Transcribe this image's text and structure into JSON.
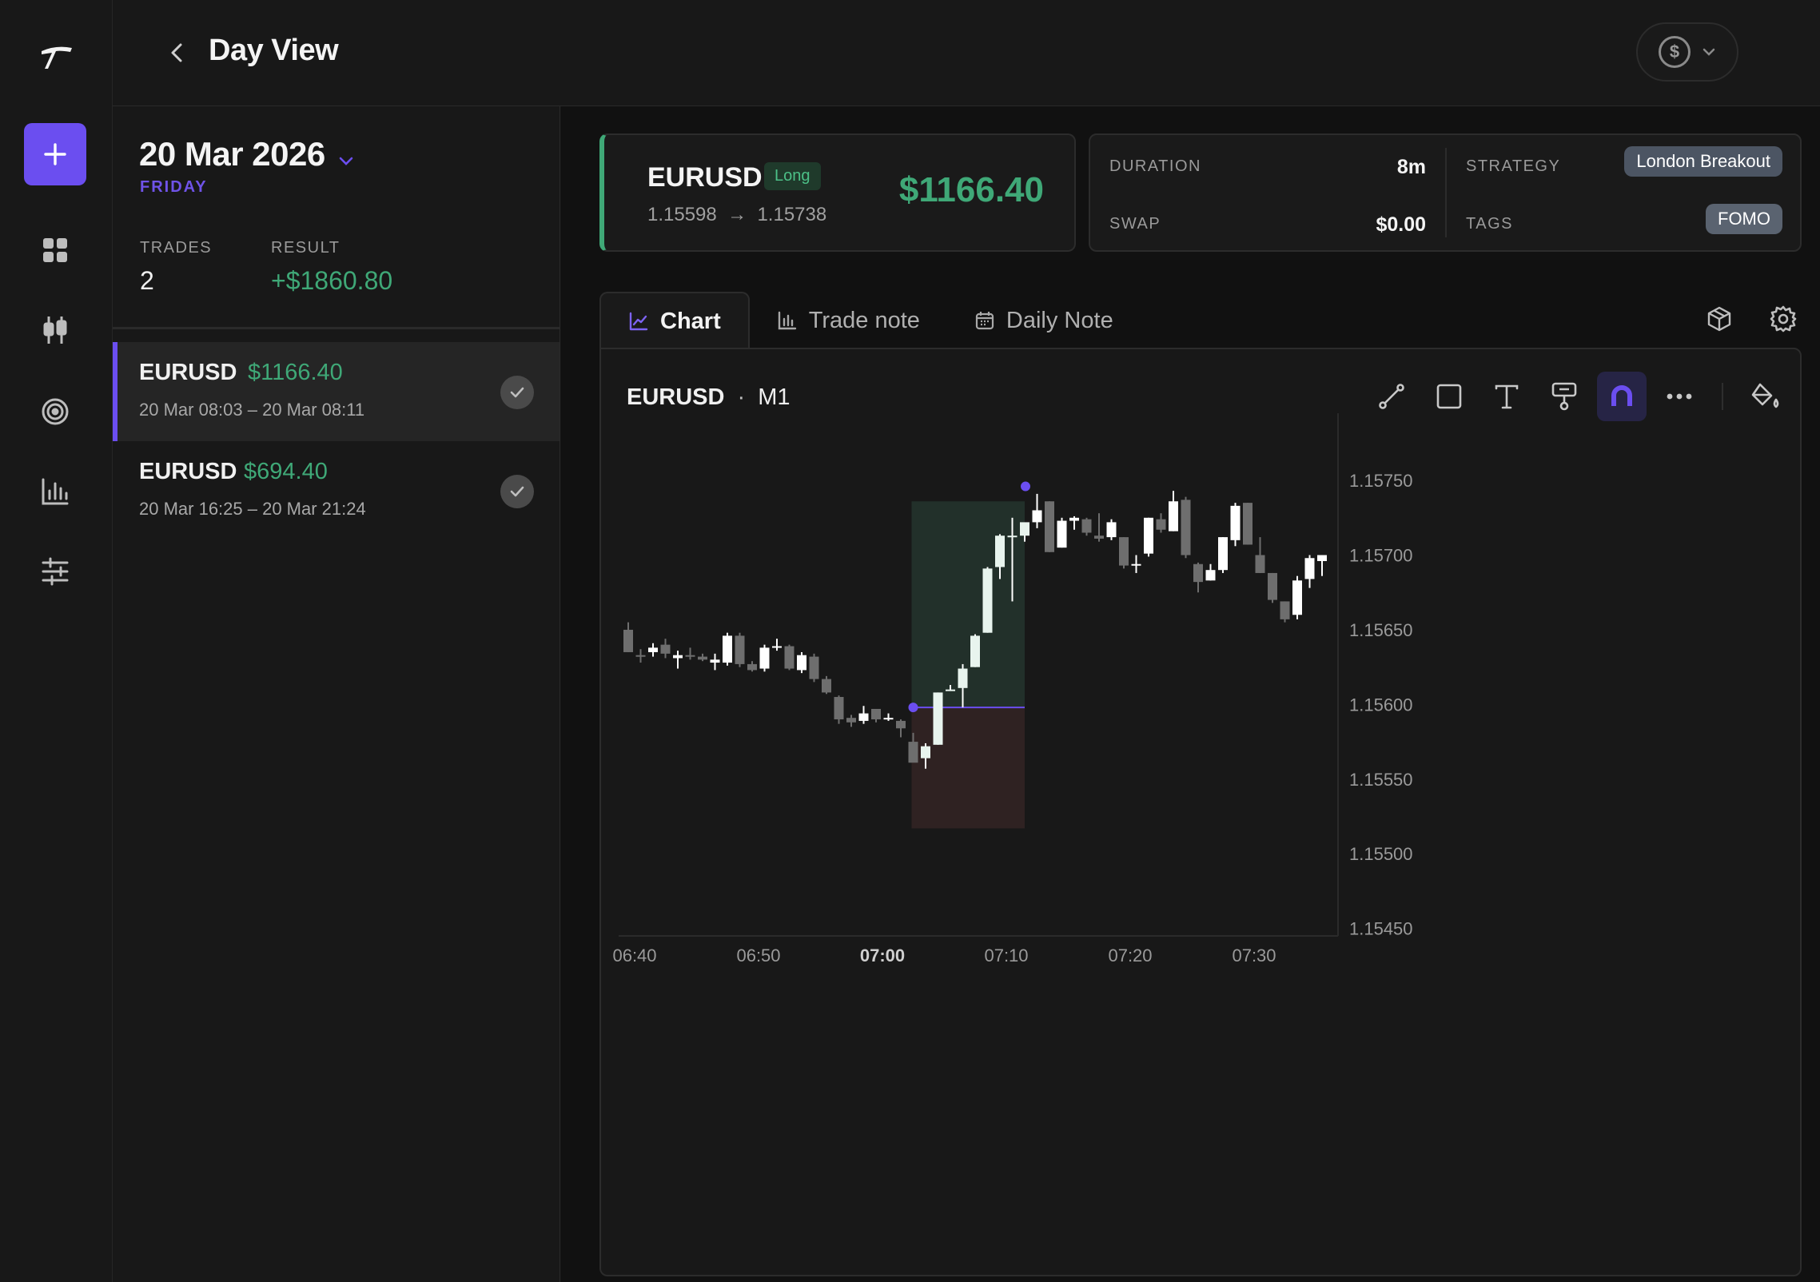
{
  "header": {
    "title": "Day View",
    "currency_symbol": "$"
  },
  "day": {
    "date": "20 Mar 2026",
    "weekday": "FRIDAY",
    "trades_label": "TRADES",
    "trades_value": "2",
    "result_label": "RESULT",
    "result_value": "+$1860.80"
  },
  "trades": [
    {
      "symbol": "EURUSD",
      "pnl": "$1166.40",
      "time": "20 Mar 08:03 – 20 Mar 08:11",
      "active": true
    },
    {
      "symbol": "EURUSD",
      "pnl": "$694.40",
      "time": "20 Mar 16:25 – 20 Mar 21:24",
      "active": false
    }
  ],
  "selected_trade": {
    "symbol": "EURUSD",
    "direction": "Long",
    "entry": "1.15598",
    "arrow": "→",
    "exit": "1.15738",
    "pnl": "$1166.40",
    "duration_label": "DURATION",
    "duration_value": "8m",
    "swap_label": "SWAP",
    "swap_value": "$0.00",
    "strategy_label": "STRATEGY",
    "strategy_value": "London Breakout",
    "tags_label": "TAGS",
    "tags_value": "FOMO"
  },
  "tabs": [
    {
      "label": "Chart",
      "active": true
    },
    {
      "label": "Trade note",
      "active": false
    },
    {
      "label": "Daily Note",
      "active": false
    }
  ],
  "chart_header": {
    "symbol": "EURUSD",
    "separator": "·",
    "timeframe": "M1"
  },
  "colors": {
    "accent": "#6b4ef0",
    "profit": "#3fa877",
    "bull_candle": "#ffffff",
    "bear_candle": "#6e6e6e",
    "profit_zone": "#22302a",
    "loss_zone": "#2f2222"
  },
  "chart_data": {
    "type": "candlestick",
    "y_ticks": [
      "1.15750",
      "1.15700",
      "1.15650",
      "1.15600",
      "1.15550",
      "1.15500",
      "1.15450"
    ],
    "ylim": [
      1.15445,
      1.15795
    ],
    "x_ticks": [
      {
        "label": "06:40",
        "minute": 0,
        "bold": false
      },
      {
        "label": "06:50",
        "minute": 10,
        "bold": false
      },
      {
        "label": "07:00",
        "minute": 20,
        "bold": true
      },
      {
        "label": "07:10",
        "minute": 30,
        "bold": false
      },
      {
        "label": "07:20",
        "minute": 40,
        "bold": false
      },
      {
        "label": "07:30",
        "minute": 50,
        "bold": false
      }
    ],
    "trade_entry": {
      "minute": 23,
      "price": 1.15598
    },
    "trade_exit": {
      "minute": 32,
      "price": 1.15738
    },
    "profit_zone": {
      "minute_start": 23,
      "minute_end": 32,
      "price_top": 1.15736,
      "price_bottom": 1.15598
    },
    "loss_zone": {
      "minute_start": 23,
      "minute_end": 32,
      "price_top": 1.15598,
      "price_bottom": 1.15517
    },
    "candles": [
      [
        1.1565,
        1.15655,
        1.15635,
        1.15635
      ],
      [
        1.15633,
        1.15637,
        1.15628,
        1.15632
      ],
      [
        1.15635,
        1.15641,
        1.15632,
        1.15638
      ],
      [
        1.1564,
        1.15644,
        1.15631,
        1.15634
      ],
      [
        1.15631,
        1.15636,
        1.15624,
        1.15633
      ],
      [
        1.15633,
        1.15638,
        1.1563,
        1.15632
      ],
      [
        1.15632,
        1.15634,
        1.15629,
        1.1563
      ],
      [
        1.15628,
        1.15634,
        1.15623,
        1.1563
      ],
      [
        1.15628,
        1.15648,
        1.15626,
        1.15646
      ],
      [
        1.15646,
        1.15648,
        1.15625,
        1.15627
      ],
      [
        1.15627,
        1.15629,
        1.15622,
        1.15623
      ],
      [
        1.15624,
        1.1564,
        1.15622,
        1.15638
      ],
      [
        1.15639,
        1.15644,
        1.15636,
        1.15639
      ],
      [
        1.15639,
        1.1564,
        1.15623,
        1.15624
      ],
      [
        1.15623,
        1.15635,
        1.15621,
        1.15633
      ],
      [
        1.15632,
        1.15634,
        1.15615,
        1.15617
      ],
      [
        1.15617,
        1.15619,
        1.15607,
        1.15608
      ],
      [
        1.15605,
        1.15606,
        1.15587,
        1.1559
      ],
      [
        1.15591,
        1.15593,
        1.15585,
        1.15588
      ],
      [
        1.15589,
        1.15599,
        1.15587,
        1.15594
      ],
      [
        1.15597,
        1.15597,
        1.15588,
        1.1559
      ],
      [
        1.1559,
        1.15594,
        1.15589,
        1.15591
      ],
      [
        1.15589,
        1.1559,
        1.15578,
        1.15584
      ],
      [
        1.15575,
        1.15581,
        1.15563,
        1.15561
      ],
      [
        1.15564,
        1.15574,
        1.15557,
        1.15572
      ],
      [
        1.15573,
        1.15608,
        1.15573,
        1.15608
      ],
      [
        1.15609,
        1.15613,
        1.15609,
        1.1561
      ],
      [
        1.15611,
        1.15627,
        1.15598,
        1.15624
      ],
      [
        1.15625,
        1.15647,
        1.15625,
        1.15646
      ],
      [
        1.15648,
        1.15692,
        1.15648,
        1.15691
      ],
      [
        1.15692,
        1.15714,
        1.15684,
        1.15713
      ],
      [
        1.15713,
        1.15725,
        1.15669,
        1.15713
      ],
      [
        1.15713,
        1.15718,
        1.15709,
        1.15722
      ],
      [
        1.15722,
        1.15741,
        1.15718,
        1.1573
      ],
      [
        1.15736,
        1.15736,
        1.15702,
        1.15702
      ],
      [
        1.15705,
        1.15725,
        1.15705,
        1.15723
      ],
      [
        1.15723,
        1.15726,
        1.15717,
        1.15725
      ],
      [
        1.15724,
        1.15725,
        1.15713,
        1.15715
      ],
      [
        1.15713,
        1.15728,
        1.15709,
        1.15711
      ],
      [
        1.15712,
        1.15724,
        1.1571,
        1.15722
      ],
      [
        1.15712,
        1.15712,
        1.15691,
        1.15693
      ],
      [
        1.15693,
        1.157,
        1.15688,
        1.15694
      ],
      [
        1.15701,
        1.15725,
        1.15699,
        1.15725
      ],
      [
        1.15724,
        1.15728,
        1.15715,
        1.15717
      ],
      [
        1.15716,
        1.15743,
        1.15716,
        1.15736
      ],
      [
        1.15737,
        1.15739,
        1.15698,
        1.157
      ],
      [
        1.15694,
        1.15695,
        1.15675,
        1.15682
      ],
      [
        1.15683,
        1.15694,
        1.15683,
        1.1569
      ],
      [
        1.1569,
        1.15712,
        1.15688,
        1.15712
      ],
      [
        1.1571,
        1.15735,
        1.15706,
        1.15733
      ],
      [
        1.15735,
        1.15735,
        1.15707,
        1.15707
      ],
      [
        1.157,
        1.15712,
        1.15688,
        1.15688
      ],
      [
        1.15688,
        1.15688,
        1.15668,
        1.1567
      ],
      [
        1.15669,
        1.15669,
        1.15655,
        1.15657
      ],
      [
        1.1566,
        1.15686,
        1.15657,
        1.15683
      ],
      [
        1.15684,
        1.157,
        1.15678,
        1.15698
      ],
      [
        1.15696,
        1.157,
        1.15686,
        1.157
      ]
    ]
  }
}
